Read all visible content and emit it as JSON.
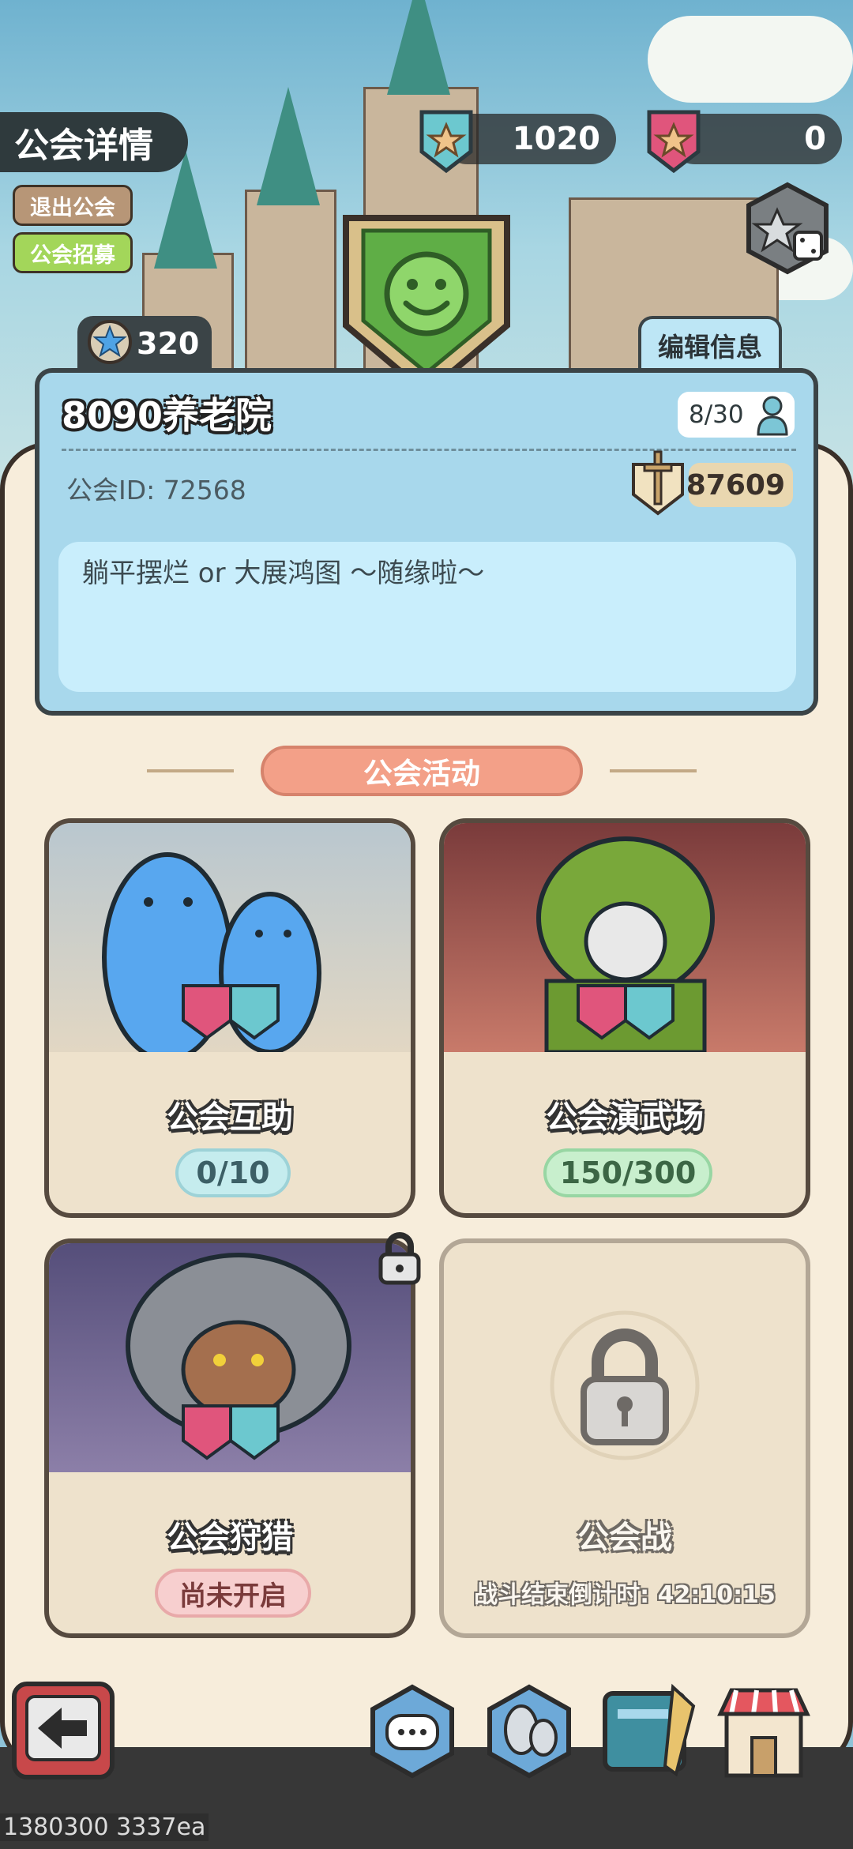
{
  "header": {
    "title": "公会详情",
    "leave_label": "退出公会",
    "recruit_label": "公会招募"
  },
  "currencies": {
    "blue_badge_count": "1020",
    "red_badge_count": "0"
  },
  "star_count": "320",
  "edit_info_label": "编辑信息",
  "guild": {
    "name": "8090养老院",
    "members": "8/30",
    "id_text": "公会ID: 72568",
    "power": "87609",
    "description": "躺平摆烂 or 大展鸿图 ～随缘啦～"
  },
  "activities_title": "公会活动",
  "activities": [
    {
      "name": "公会互助",
      "status": "0/10"
    },
    {
      "name": "公会演武场",
      "status": "150/300"
    },
    {
      "name": "公会狩猎",
      "status": "尚未开启"
    },
    {
      "name": "公会战",
      "status": "战斗结束倒计时: 42:10:15"
    }
  ],
  "footer_text": "1380300 3337ea",
  "icons": [
    "back-arrow-icon",
    "chat-icon",
    "members-icon",
    "book-icon",
    "shop-icon",
    "dice-icon",
    "lock-icon",
    "person-icon",
    "sword-crest-icon",
    "star-icon"
  ],
  "colors": {
    "panel": "#f7eddb",
    "card": "#a8d8ec",
    "accent": "#f3a088",
    "green_badge": "#5fae46"
  }
}
